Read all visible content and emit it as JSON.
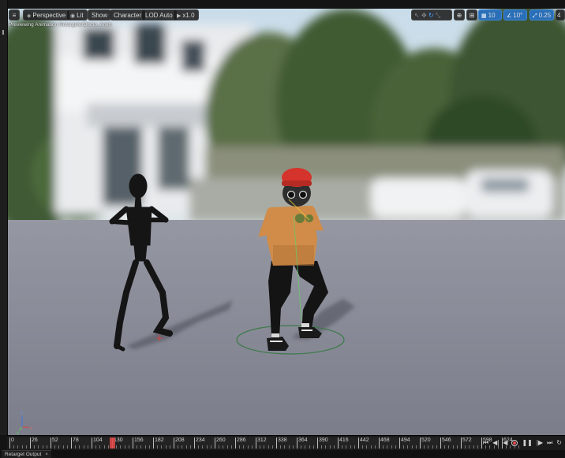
{
  "toolbar": {
    "menu_icon": "hamburger-icon",
    "perspective_label": "Perspective",
    "lit_label": "Lit",
    "show_label": "Show",
    "character_label": "Character",
    "lod_label": "LOD Auto",
    "play_rate_label": "x1.0",
    "grid_snap_value": "10",
    "rotation_snap_value": "10°",
    "scale_snap_value": "0.25",
    "camera_speed_value": "4"
  },
  "viewport": {
    "preview_text": "Previewing Animation RetargeterDemo_Anim"
  },
  "timeline": {
    "frame_labels": [
      "0",
      "26",
      "52",
      "78",
      "104",
      "130",
      "156",
      "182",
      "208",
      "234",
      "260",
      "286",
      "312",
      "338",
      "364",
      "390",
      "416",
      "442",
      "468",
      "494",
      "520",
      "546",
      "572",
      "598",
      "624"
    ],
    "current_frame": 130,
    "transport_icons": [
      "skip-to-start-icon",
      "step-back-icon",
      "play-reverse-icon",
      "record-icon",
      "pause-icon",
      "step-forward-icon",
      "skip-to-end-icon",
      "loop-icon"
    ]
  },
  "tabs": [
    {
      "label": "Retarget Output",
      "close": "×"
    }
  ],
  "colors": {
    "accent_blue": "#2a6fb8",
    "playhead_red": "#e04848",
    "floor": "#8a8c98",
    "hoodie": "#d08c48",
    "beanie": "#d4342c"
  }
}
